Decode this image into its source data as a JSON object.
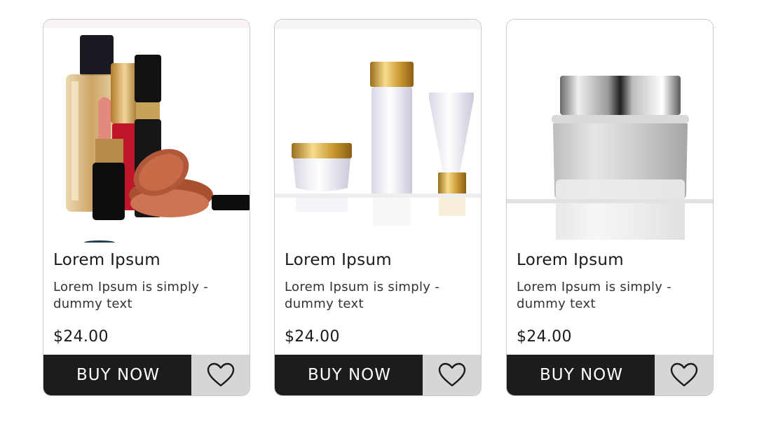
{
  "products": [
    {
      "image_name": "makeup-set-photo",
      "title": "Lorem Ipsum",
      "description": "Lorem Ipsum is simply - dummy text",
      "price": "$24.00",
      "buy_label": "BUY NOW",
      "favorite_icon": "heart-outline-icon"
    },
    {
      "image_name": "skincare-bottles-photo",
      "title": "Lorem Ipsum",
      "description": "Lorem Ipsum is simply - dummy text",
      "price": "$24.00",
      "buy_label": "BUY NOW",
      "favorite_icon": "heart-outline-icon"
    },
    {
      "image_name": "cream-jar-photo",
      "title": "Lorem Ipsum",
      "description": "Lorem Ipsum is simply - dummy text",
      "price": "$24.00",
      "buy_label": "BUY NOW",
      "favorite_icon": "heart-outline-icon"
    }
  ],
  "colors": {
    "buy_bg": "#1c1c1c",
    "favorite_bg": "#d6d6d6",
    "card_border": "#c9c9c9"
  }
}
